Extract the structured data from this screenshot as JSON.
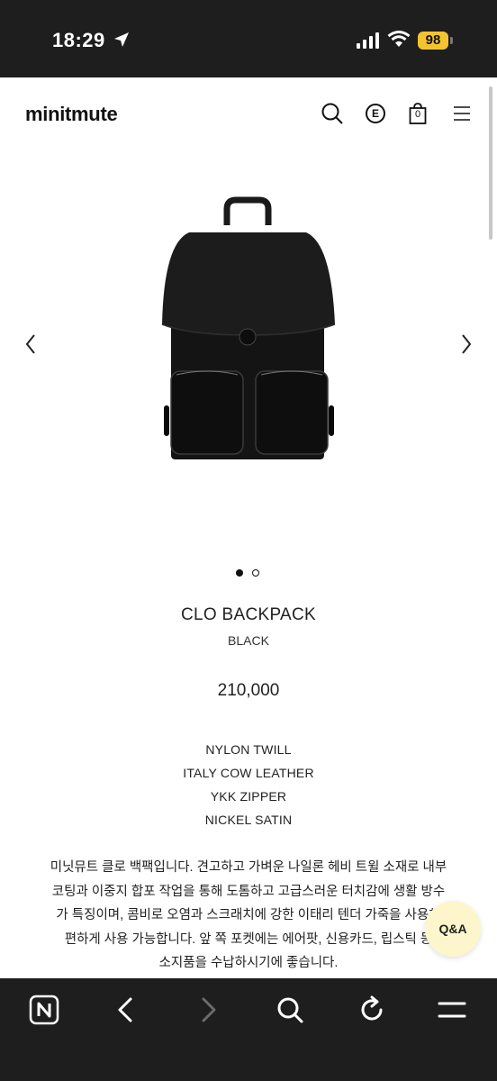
{
  "status_bar": {
    "time": "18:29",
    "battery": "98"
  },
  "header": {
    "logo": "minitmute",
    "cart_count": "0",
    "brand_icon_letter": "E"
  },
  "product": {
    "name": "CLO BACKPACK",
    "color": "BLACK",
    "price": "210,000",
    "specs": [
      "NYLON TWILL",
      "ITALY COW LEATHER",
      "YKK ZIPPER",
      "NICKEL SATIN"
    ],
    "description_lines": [
      "미닛뮤트 클로 백팩입니다. 견고하고 가벼운 나일론 헤비 트윌 소재로 내부",
      "코팅과 이중지 합포 작업을 통해 도톰하고 고급스러운 터치감에 생활 방수",
      "가 특징이며, 콤비로 오염과 스크래치에 강한 이태리 텐더 가죽을 사용해",
      "편하게 사용 가능합니다. 앞 쪽 포켓에는 에어팟, 신용카드, 립스틱 등",
      "소지품을 수납하시기에 좋습니다."
    ],
    "carousel": {
      "current": 1,
      "total": 2
    }
  },
  "qa_button": {
    "label": "Q&A"
  },
  "colors": {
    "status_bar_bg": "#1e1e1e",
    "qa_bg": "#fdf6cc",
    "battery": "#f4c430"
  }
}
